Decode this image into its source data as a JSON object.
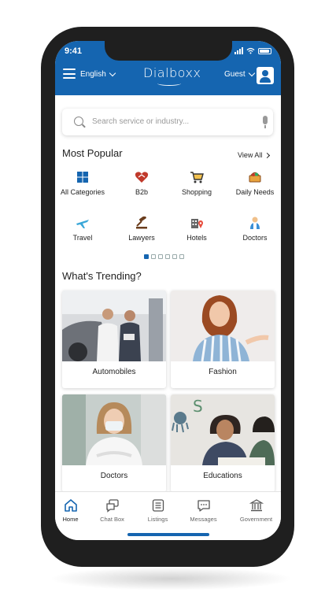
{
  "colors": {
    "brand": "#1565b0",
    "phone_frame": "#1f1f1f",
    "text": "#222222"
  },
  "status_bar": {
    "time": "9:41"
  },
  "header": {
    "language": "English",
    "logo": "Dialboxx",
    "user_label": "Guest"
  },
  "search": {
    "placeholder": "Search service or industry..."
  },
  "popular": {
    "title": "Most Popular",
    "view_all": "View All",
    "categories": [
      {
        "label": "All Categories",
        "icon": "grid-icon"
      },
      {
        "label": "B2b",
        "icon": "handshake-heart-icon"
      },
      {
        "label": "Shopping",
        "icon": "shopping-cart-icon"
      },
      {
        "label": "Daily Needs",
        "icon": "basket-icon"
      },
      {
        "label": "Travel",
        "icon": "airplane-icon"
      },
      {
        "label": "Lawyers",
        "icon": "gavel-icon"
      },
      {
        "label": "Hotels",
        "icon": "hotel-icon"
      },
      {
        "label": "Doctors",
        "icon": "doctor-icon"
      }
    ],
    "pagination": {
      "pages": 6,
      "active": 1
    }
  },
  "trending": {
    "title": "What's Trending?",
    "cards": [
      {
        "label": "Automobiles"
      },
      {
        "label": "Fashion"
      },
      {
        "label": "Doctors"
      },
      {
        "label": "Educations"
      }
    ]
  },
  "bottom_nav": {
    "items": [
      {
        "label": "Home",
        "icon": "home-icon",
        "active": true
      },
      {
        "label": "Chat Box",
        "icon": "chat-icon"
      },
      {
        "label": "Listings",
        "icon": "list-icon"
      },
      {
        "label": "Messages",
        "icon": "message-icon"
      },
      {
        "label": "Government",
        "icon": "government-building-icon"
      }
    ]
  }
}
